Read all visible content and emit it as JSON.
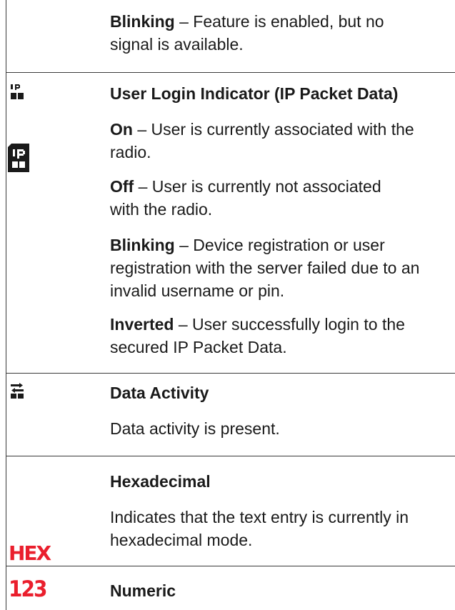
{
  "rows": [
    {
      "blocks": [
        {
          "term": "Blinking",
          "desc": " – Feature is enabled, but no signal is available."
        }
      ]
    },
    {
      "title": "User Login Indicator (IP Packet Data)",
      "icon_small": "ip-icon",
      "icon_large": "ip-inverted-icon",
      "icon_text": "IP",
      "blocks": [
        {
          "term": "On",
          "desc": " – User is currently associated with the radio."
        },
        {
          "term": "Off",
          "desc": " – User is currently not associated with the radio."
        },
        {
          "term": "Blinking",
          "desc": " – Device registration or user registration with the server failed due to an invalid username or pin."
        },
        {
          "term": "Inverted",
          "desc": " – User successfully login to the secured IP Packet Data."
        }
      ]
    },
    {
      "title": "Data Activity",
      "icon": "data-activity-icon",
      "text": "Data activity is present."
    },
    {
      "title": "Hexadecimal",
      "icon": "hex-icon",
      "icon_text": "HEX",
      "text": "Indicates that the text entry is currently in hexadecimal mode."
    },
    {
      "title": "Numeric",
      "icon": "numeric-icon",
      "icon_text": "123"
    }
  ]
}
